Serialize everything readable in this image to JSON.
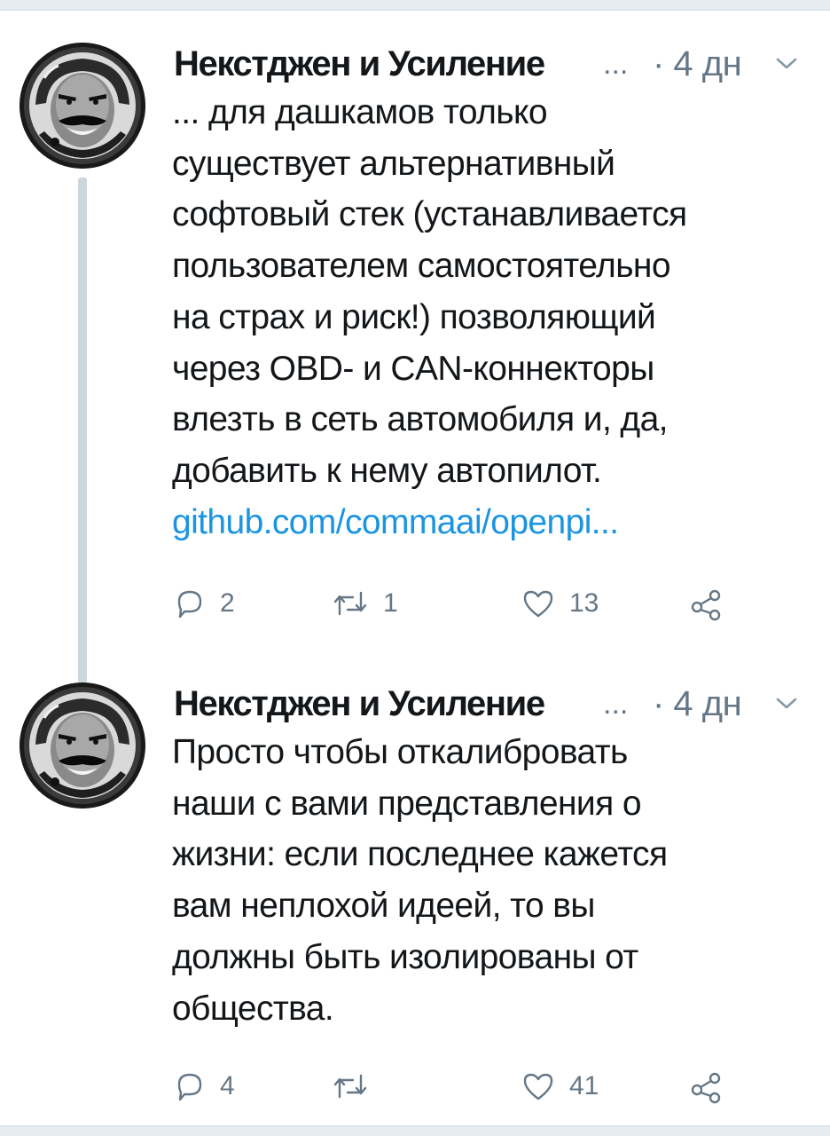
{
  "colors": {
    "link": "#1b95e0",
    "secondary_text": "#657786",
    "primary_text": "#14171a",
    "divider": "#e6ecf0",
    "thread_line": "#ccd6dd"
  },
  "tweets": [
    {
      "author": {
        "name": "Некстджен и Усиление",
        "name_ellipsis": "...",
        "avatar_icon": "astronaut-helmet-portrait"
      },
      "timestamp": "· 4 дн",
      "text_lines": [
        "... для дашкамов только",
        "существует альтернативный",
        "софтовый стек (устанавливается",
        "пользователем самостоятельно",
        "на страх и риск!) позволяющий",
        "через OBD- и CAN-коннекторы",
        "влезть в сеть автомобиля и, да,",
        "добавить к нему автопилот."
      ],
      "link_text": "github.com/commaai/openpi...",
      "actions": {
        "reply_count": "2",
        "retweet_count": "1",
        "like_count": "13"
      }
    },
    {
      "author": {
        "name": "Некстджен и Усиление",
        "name_ellipsis": "...",
        "avatar_icon": "astronaut-helmet-portrait"
      },
      "timestamp": "· 4 дн",
      "text_lines": [
        "Просто чтобы откалибровать",
        "наши с вами представления о",
        "жизни: если последнее кажется",
        "вам неплохой идеей, то вы",
        "должны быть изолированы от",
        "общества."
      ],
      "actions": {
        "reply_count": "4",
        "retweet_count": "",
        "like_count": "41"
      }
    }
  ]
}
